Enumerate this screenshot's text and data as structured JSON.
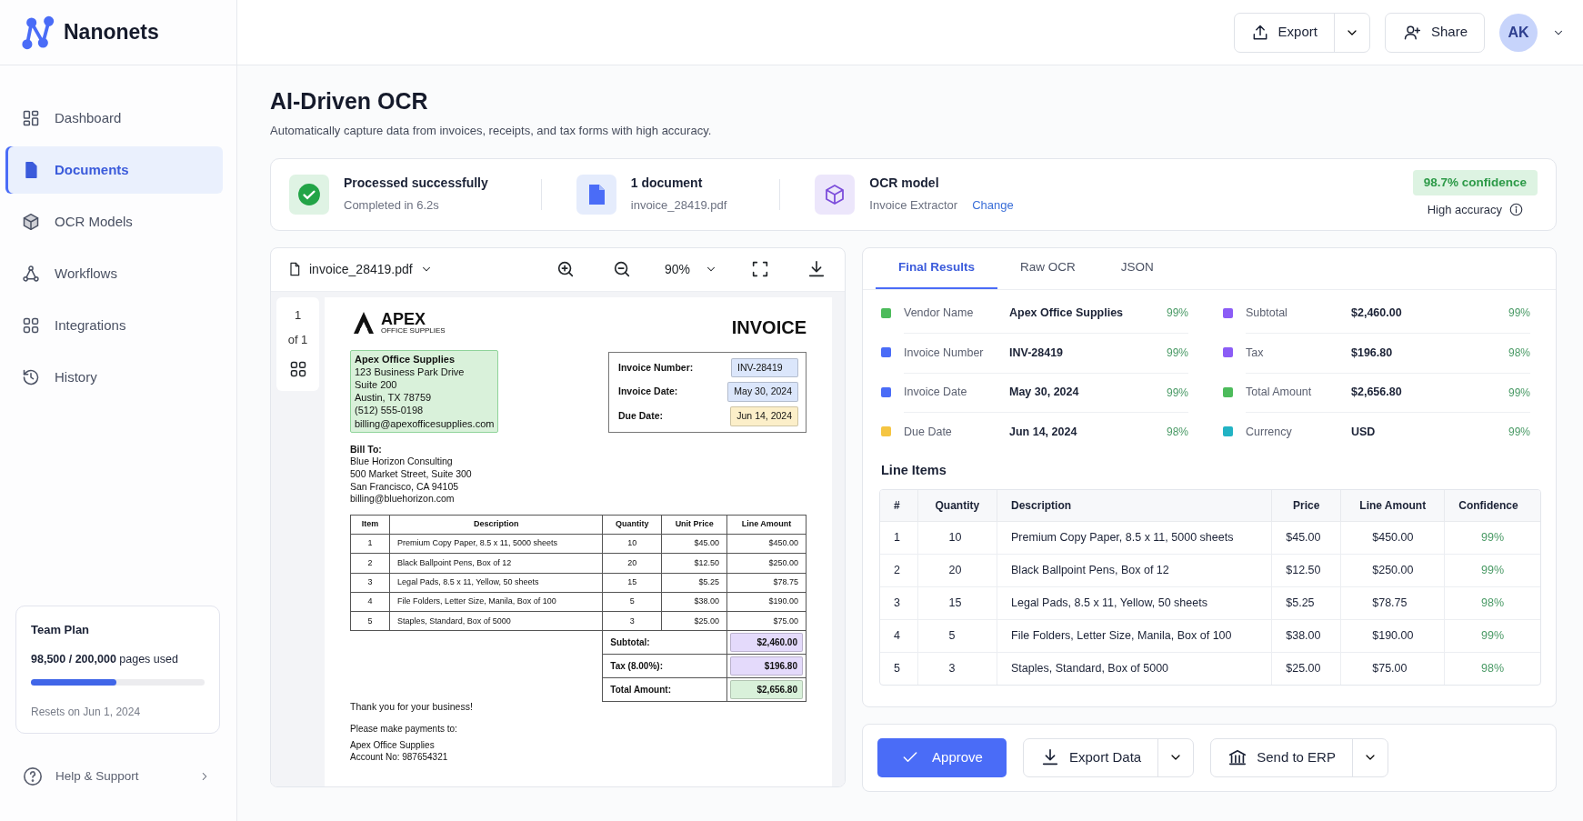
{
  "brand": {
    "name": "Nanonets"
  },
  "header": {
    "export": "Export",
    "share": "Share",
    "avatar": "AK"
  },
  "sidebar": {
    "items": [
      {
        "label": "Dashboard",
        "kind": "dashboard",
        "selected": false
      },
      {
        "label": "Documents",
        "kind": "document",
        "selected": true
      },
      {
        "label": "OCR Models",
        "kind": "cube",
        "selected": false
      },
      {
        "label": "Workflows",
        "kind": "workflow",
        "selected": false
      },
      {
        "label": "Integrations",
        "kind": "grid",
        "selected": false
      },
      {
        "label": "History",
        "kind": "history",
        "selected": false
      }
    ],
    "plan": {
      "title": "Team Plan",
      "usage_count": "98,500 / 200,000",
      "usage_text": "pages used",
      "level": 0.4925,
      "resets": "Resets on Jun 1, 2024"
    },
    "help": "Help & Support"
  },
  "page": {
    "title": "AI-Driven OCR",
    "subtitle": "Automatically capture data from invoices, receipts, and tax forms with high accuracy."
  },
  "summary": {
    "status": {
      "title": "Processed successfully",
      "detail": "Completed in 6.2s"
    },
    "document": {
      "title": "1 document",
      "detail": "invoice_28419.pdf"
    },
    "model": {
      "title": "OCR model",
      "detail": "Invoice Extractor",
      "link": "Change"
    },
    "confidence": "98.7% confidence",
    "accuracy": "High accuracy"
  },
  "viewer": {
    "file": "invoice_28419.pdf",
    "zoom": "90%",
    "page": "1",
    "page_of": "of 1",
    "invoice": {
      "logo_name": "APEX",
      "logo_sub": "OFFICE SUPPLIES",
      "title": "INVOICE",
      "vendor": {
        "name": "Apex Office Supplies",
        "lines": [
          "123 Business Park Drive",
          "Suite 200",
          "Austin, TX 78759",
          "(512) 555-0198",
          "billing@apexofficesupplies.com"
        ],
        "color": "#d9f1da"
      },
      "meta": [
        {
          "label": "Invoice Number:",
          "value": "INV-28419",
          "color": "#dbe6fb"
        },
        {
          "label": "Invoice Date:",
          "value": "May 30, 2024",
          "color": "#dbe6fb"
        },
        {
          "label": "Due Date:",
          "value": "Jun 14, 2024",
          "color": "#fcefc9"
        }
      ],
      "bill_to": {
        "label": "Bill To:",
        "lines": [
          "Blue Horizon Consulting",
          "500 Market Street, Suite 300",
          "San Francisco, CA 94105",
          "billing@bluehorizon.com"
        ]
      },
      "columns": [
        "Item",
        "Description",
        "Quantity",
        "Unit Price",
        "Line Amount"
      ],
      "rows": [
        [
          "1",
          "Premium Copy Paper, 8.5 x 11, 5000 sheets",
          "10",
          "$45.00",
          "$450.00"
        ],
        [
          "2",
          "Black Ballpoint Pens, Box of 12",
          "20",
          "$12.50",
          "$250.00"
        ],
        [
          "3",
          "Legal Pads, 8.5 x 11, Yellow, 50 sheets",
          "15",
          "$5.25",
          "$78.75"
        ],
        [
          "4",
          "File Folders, Letter Size, Manila, Box of 100",
          "5",
          "$38.00",
          "$190.00"
        ],
        [
          "5",
          "Staples, Standard, Box of 5000",
          "3",
          "$25.00",
          "$75.00"
        ]
      ],
      "totals": [
        {
          "label": "Subtotal:",
          "value": "$2,460.00",
          "color": "#e4dafb"
        },
        {
          "label": "Tax (8.00%):",
          "value": "$196.80",
          "color": "#e4dafb"
        },
        {
          "label": "Total Amount:",
          "value": "$2,656.80",
          "color": "#d9f1da"
        }
      ],
      "thanks": "Thank you for your business!",
      "payment": [
        "Please make payments to:",
        "Apex Office Supplies",
        "Account No: 987654321"
      ]
    }
  },
  "results": {
    "tabs": [
      {
        "label": "Final Results",
        "selected": true
      },
      {
        "label": "Raw OCR",
        "selected": false
      },
      {
        "label": "JSON",
        "selected": false
      }
    ],
    "field_groups": [
      {
        "fields": [
          {
            "label": "Vendor Name",
            "value": "Apex Office Supplies",
            "confidence": "99%",
            "color": "#4cbb5b"
          },
          {
            "label": "Invoice Number",
            "value": "INV-28419",
            "confidence": "99%",
            "color": "#4a6cf7"
          },
          {
            "label": "Invoice Date",
            "value": "May 30, 2024",
            "confidence": "99%",
            "color": "#4a6cf7"
          },
          {
            "label": "Due Date",
            "value": "Jun 14, 2024",
            "confidence": "98%",
            "color": "#f5c542"
          }
        ]
      },
      {
        "fields": [
          {
            "label": "Subtotal",
            "value": "$2,460.00",
            "confidence": "99%",
            "color": "#8b5cf6"
          },
          {
            "label": "Tax",
            "value": "$196.80",
            "confidence": "98%",
            "color": "#8b5cf6"
          },
          {
            "label": "Total Amount",
            "value": "$2,656.80",
            "confidence": "99%",
            "color": "#4cbb5b"
          },
          {
            "label": "Currency",
            "value": "USD",
            "confidence": "99%",
            "color": "#22b3c4"
          }
        ]
      }
    ],
    "line_items_title": "Line Items",
    "columns": [
      "#",
      "Quantity",
      "Description",
      "Price",
      "Line Amount",
      "Confidence"
    ],
    "rows": [
      [
        "1",
        "10",
        "Premium Copy Paper, 8.5 x 11, 5000 sheets",
        "$45.00",
        "$450.00",
        "99%"
      ],
      [
        "2",
        "20",
        "Black Ballpoint Pens, Box of 12",
        "$12.50",
        "$250.00",
        "99%"
      ],
      [
        "3",
        "15",
        "Legal Pads, 8.5 x 11, Yellow, 50 sheets",
        "$5.25",
        "$78.75",
        "98%"
      ],
      [
        "4",
        "5",
        "File Folders, Letter Size, Manila, Box of 100",
        "$38.00",
        "$190.00",
        "99%"
      ],
      [
        "5",
        "3",
        "Staples, Standard, Box of 5000",
        "$25.00",
        "$75.00",
        "98%"
      ]
    ]
  },
  "actions": {
    "approve": "Approve",
    "export_data": "Export Data",
    "send_erp": "Send to ERP"
  }
}
